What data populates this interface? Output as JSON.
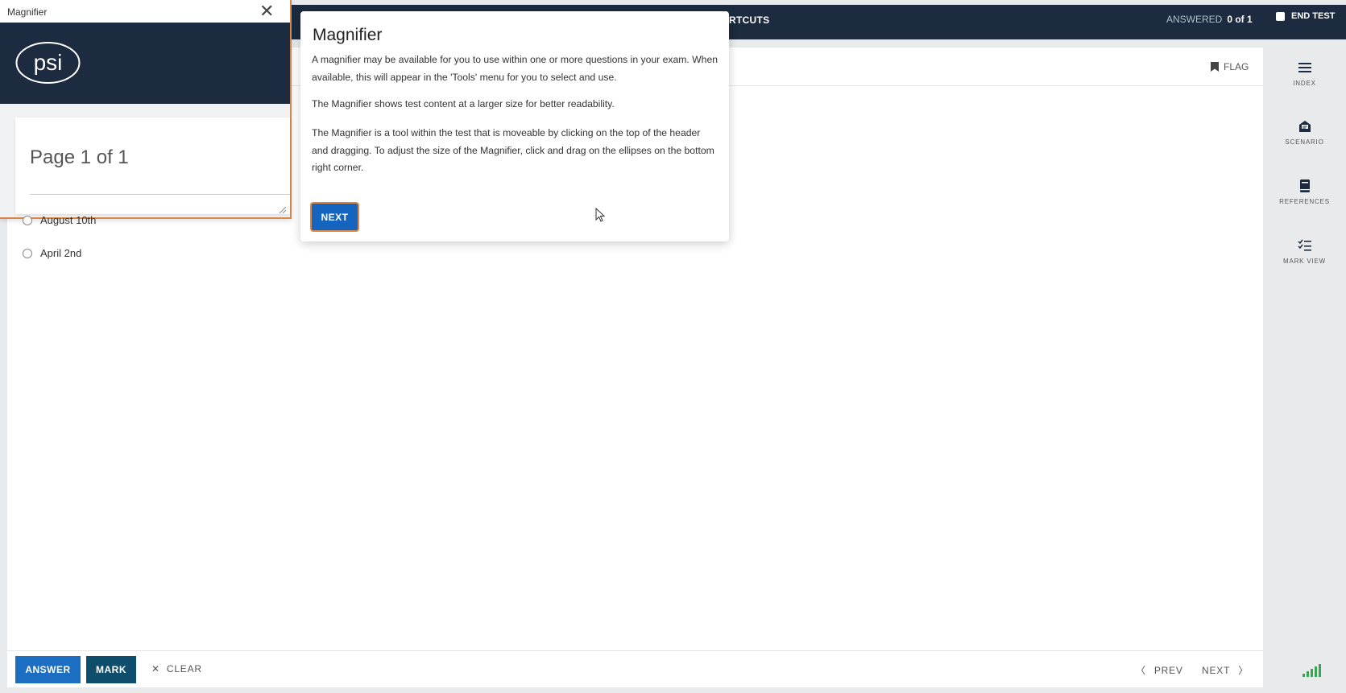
{
  "header": {
    "shortcuts_label": "RTCUTS",
    "answered_label": "ANSWERED",
    "answered_value": "0 of 1",
    "end_test_label": "END TEST"
  },
  "question": {
    "flag_label": "FLAG",
    "options": [
      "August 10th",
      "April 2nd"
    ]
  },
  "sidebar": {
    "items": [
      {
        "label": "INDEX",
        "icon": "menu-icon"
      },
      {
        "label": "SCENARIO",
        "icon": "scenario-icon"
      },
      {
        "label": "REFERENCES",
        "icon": "book-icon"
      },
      {
        "label": "MARK VIEW",
        "icon": "checklist-icon"
      }
    ]
  },
  "footer": {
    "answer_label": "ANSWER",
    "mark_label": "MARK",
    "clear_label": "CLEAR",
    "prev_label": "PREV",
    "next_label": "NEXT"
  },
  "magnifier": {
    "title": "Magnifier",
    "logo_text": "psi",
    "page_label": "Page 1 of 1",
    "option_partial": "August 10th"
  },
  "dialog": {
    "title": "Magnifier",
    "paragraphs": [
      "A magnifier may be available for you to use within one or more questions in your exam. When available, this will appear in the 'Tools' menu for you to select and use.",
      "The Magnifier shows test content at a larger size for better readability.",
      "The Magnifier is a tool within the test that is moveable by clicking on the top of the header and dragging. To adjust the size of the Magnifier, click and drag on the ellipses on the bottom right corner."
    ],
    "next_label": "NEXT"
  },
  "colors": {
    "navy": "#1c2b40",
    "primary_blue": "#1b6ec2",
    "mark_teal": "#0e4d6b",
    "accent_orange": "#d8874b",
    "signal_green": "#3aa655"
  }
}
